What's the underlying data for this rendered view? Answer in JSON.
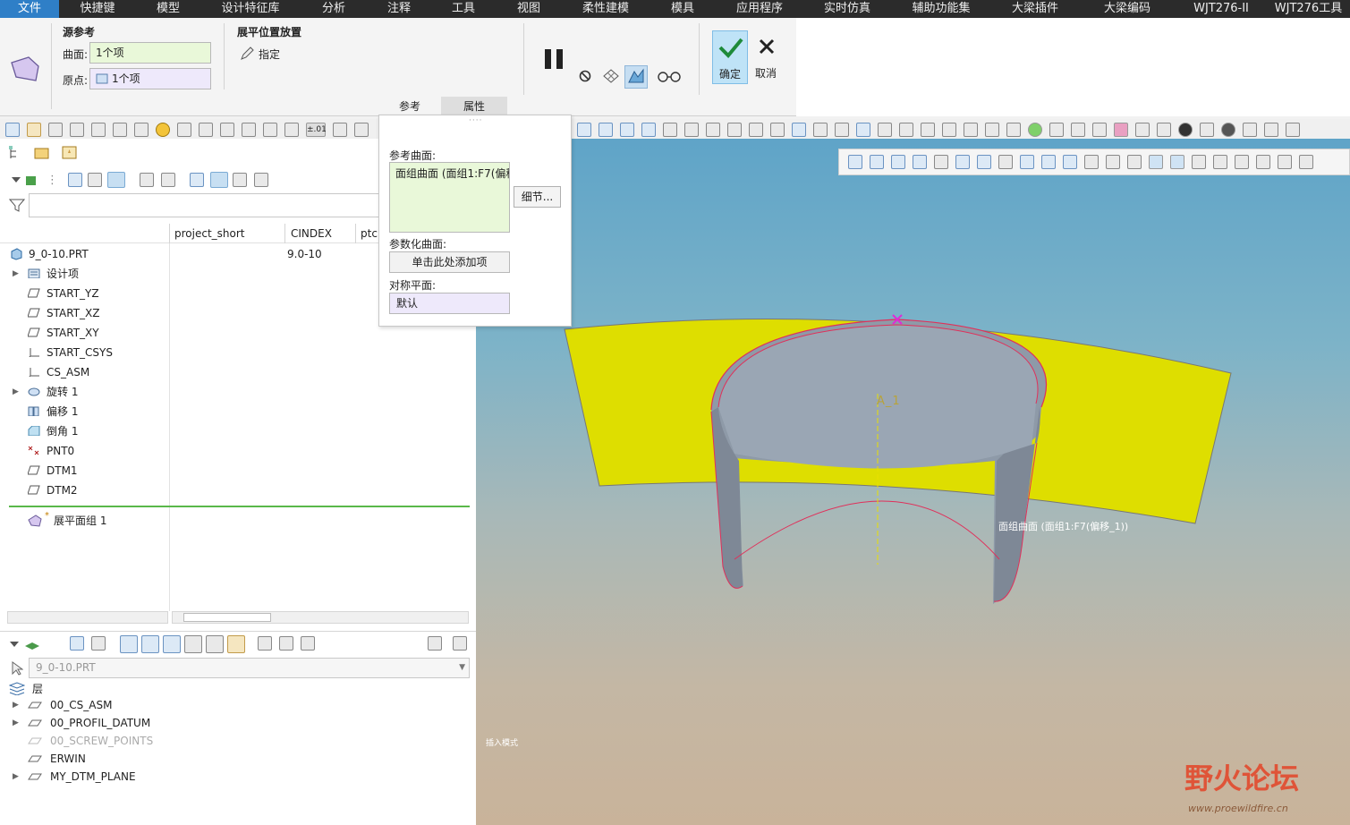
{
  "menu": {
    "items": [
      "文件",
      "快捷键",
      "模型",
      "设计特征库",
      "分析",
      "注释",
      "工具",
      "视图",
      "柔性建模",
      "模具",
      "应用程序",
      "实时仿真",
      "辅助功能集",
      "大梁插件",
      "大梁编码",
      "WJT276-II",
      "WJT276工具"
    ],
    "active": "文件"
  },
  "ribbon": {
    "source_ref_title": "源参考",
    "surface_label": "曲面:",
    "surface_value": "1个项",
    "origin_label": "原点:",
    "origin_value": "1个项",
    "flatten_title": "展平位置放置",
    "specify_label": "指定",
    "ok_label": "确定",
    "cancel_label": "取消",
    "tabs": [
      "参考",
      "属性"
    ]
  },
  "panel": {
    "ref_surface_label": "参考曲面:",
    "ref_surface_value": "面组曲面 (面组1:F7(偏移",
    "details_button": "细节...",
    "param_surface_label": "参数化曲面:",
    "add_item_text": "单击此处添加项",
    "sym_plane_label": "对称平面:",
    "sym_plane_value": "默认"
  },
  "model_tree": {
    "columns": [
      "project_short",
      "CINDEX",
      "ptc"
    ],
    "root": {
      "label": "9_0-10.PRT",
      "cindex": "9.0-10"
    },
    "items": [
      {
        "label": "设计项",
        "icon": "design-items-icon",
        "expand": true
      },
      {
        "label": "START_YZ",
        "icon": "datum-plane-icon",
        "expand": false
      },
      {
        "label": "START_XZ",
        "icon": "datum-plane-icon",
        "expand": false
      },
      {
        "label": "START_XY",
        "icon": "datum-plane-icon",
        "expand": false
      },
      {
        "label": "START_CSYS",
        "icon": "csys-icon",
        "expand": false
      },
      {
        "label": "CS_ASM",
        "icon": "csys-icon",
        "expand": false
      },
      {
        "label": "旋转 1",
        "icon": "revolve-icon",
        "expand": true
      },
      {
        "label": "偏移 1",
        "icon": "offset-icon",
        "expand": false
      },
      {
        "label": "倒角 1",
        "icon": "chamfer-icon",
        "expand": false
      },
      {
        "label": "PNT0",
        "icon": "datum-point-icon",
        "expand": false
      },
      {
        "label": "DTM1",
        "icon": "datum-plane-icon",
        "expand": false
      },
      {
        "label": "DTM2",
        "icon": "datum-plane-icon",
        "expand": false
      }
    ],
    "inserted": {
      "label": "展平面组 1",
      "marker": "*"
    }
  },
  "layer_tree": {
    "selector_value": "9_0-10.PRT",
    "header": "层",
    "layers": [
      {
        "label": "00_CS_ASM",
        "expand": true,
        "dim": false
      },
      {
        "label": "00_PROFIL_DATUM",
        "expand": true,
        "dim": false
      },
      {
        "label": "00_SCREW_POINTS",
        "expand": false,
        "dim": true
      },
      {
        "label": "ERWIN",
        "expand": false,
        "dim": false
      },
      {
        "label": "MY_DTM_PLANE",
        "expand": true,
        "dim": false
      }
    ]
  },
  "viewport": {
    "axis_label": "A_1",
    "surface_annotation": "面组曲面 (面组1:F7(偏移_1))",
    "mode_text": "插入模式",
    "watermark_main": "野火论坛",
    "watermark_url": "www.proewildfire.cn",
    "flat_surface_color": "#dede00",
    "cylinder_color": "#8e9aa8",
    "edge_color": "#e0305a"
  },
  "colors": {
    "menu_bg": "#2b2b2b",
    "accent": "#2f7fc7",
    "ok_bg": "#bfe3f7"
  }
}
